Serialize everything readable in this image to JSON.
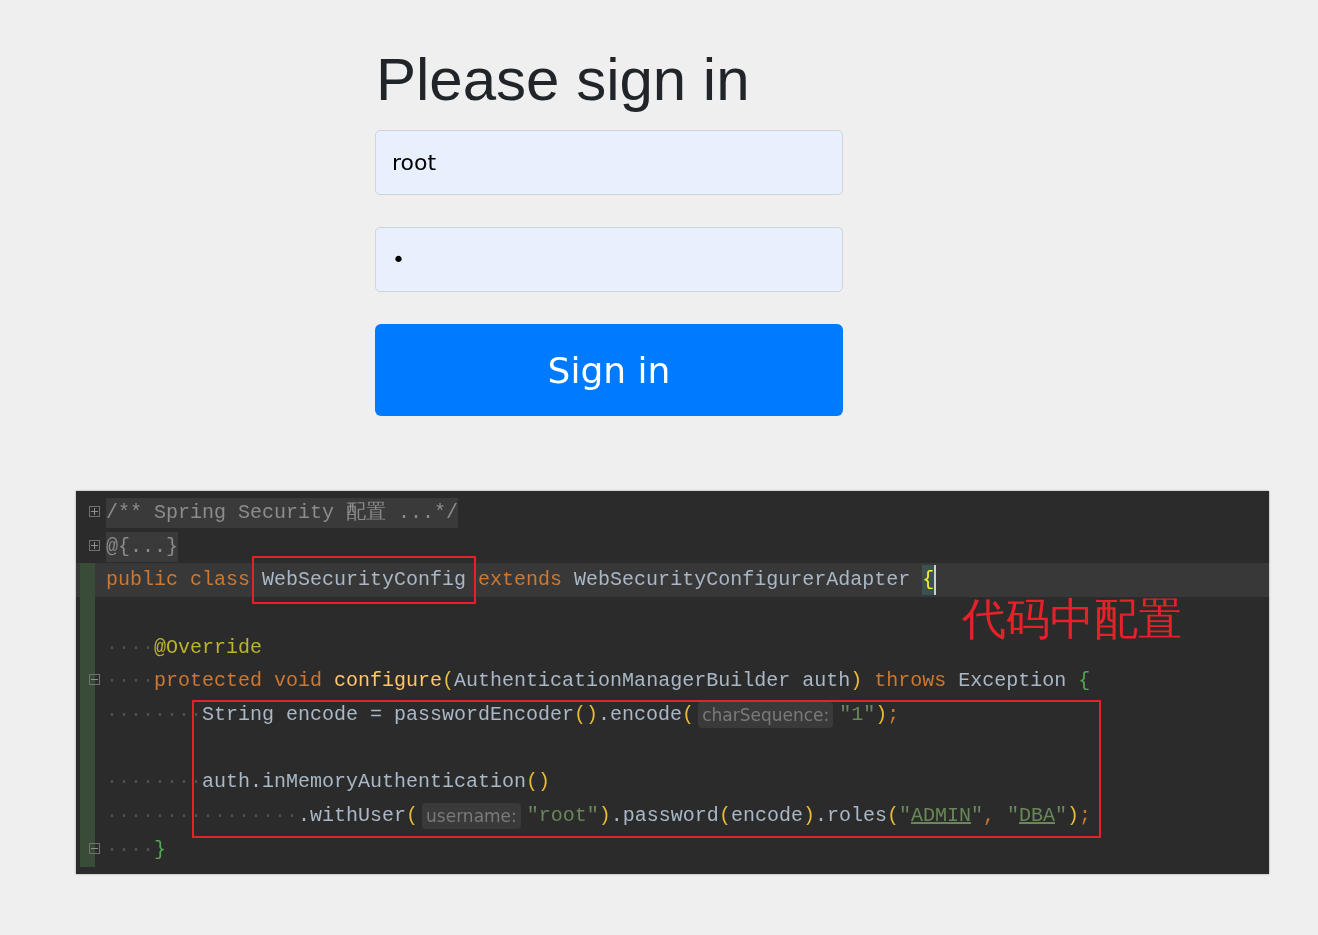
{
  "login": {
    "heading": "Please sign in",
    "username": {
      "value": "root"
    },
    "password": {
      "value": "•"
    },
    "button": "Sign in"
  },
  "code_editor": {
    "lines": [
      {
        "kind": "code",
        "fold": {
          "collapsed": true
        },
        "tokens": [
          {
            "kind": "folded",
            "text": "/** Spring Security 配置 ...*/"
          }
        ]
      },
      {
        "kind": "code",
        "fold": {
          "collapsed": true
        },
        "tokens": [
          {
            "kind": "folded",
            "text": "@{...}"
          }
        ]
      },
      {
        "kind": "code",
        "current": true,
        "tokens": [
          {
            "kind": "keyword",
            "text": "public class "
          },
          {
            "kind": "plain",
            "text": "WebSecurityConfig",
            "framed": true
          },
          {
            "kind": "keyword",
            "text": " extends "
          },
          {
            "kind": "plain",
            "text": "WebSecurityConfigurerAdapter "
          },
          {
            "kind": "brace_match",
            "text": "{"
          }
        ]
      },
      {
        "kind": "blank"
      },
      {
        "kind": "code",
        "tokens": [
          {
            "kind": "ws",
            "text": "····"
          },
          {
            "kind": "annotation",
            "text": "@Override"
          }
        ]
      },
      {
        "kind": "code",
        "fold": {
          "collapsed": false
        },
        "tokens": [
          {
            "kind": "ws",
            "text": "····"
          },
          {
            "kind": "keyword",
            "text": "protected void "
          },
          {
            "kind": "method",
            "text": "configure"
          },
          {
            "kind": "paren",
            "text": "("
          },
          {
            "kind": "plain",
            "text": "AuthenticationManagerBuilder auth"
          },
          {
            "kind": "paren",
            "text": ")"
          },
          {
            "kind": "keyword",
            "text": " throws "
          },
          {
            "kind": "plain",
            "text": "Exception "
          },
          {
            "kind": "brace",
            "text": "{"
          }
        ]
      },
      {
        "kind": "code",
        "tokens": [
          {
            "kind": "ws",
            "text": "········"
          },
          {
            "kind": "plain",
            "text": "String encode = passwordEncoder"
          },
          {
            "kind": "paren",
            "text": "()"
          },
          {
            "kind": "plain",
            "text": ".encode"
          },
          {
            "kind": "paren",
            "text": "("
          },
          {
            "kind": "hint",
            "text": "charSequence:"
          },
          {
            "kind": "string",
            "text": "\"1\""
          },
          {
            "kind": "paren",
            "text": ")"
          },
          {
            "kind": "keyword",
            "text": ";"
          }
        ]
      },
      {
        "kind": "blank"
      },
      {
        "kind": "code",
        "tokens": [
          {
            "kind": "ws",
            "text": "········"
          },
          {
            "kind": "plain",
            "text": "auth.inMemoryAuthentication"
          },
          {
            "kind": "paren",
            "text": "()"
          }
        ]
      },
      {
        "kind": "code",
        "tokens": [
          {
            "kind": "ws",
            "text": "················"
          },
          {
            "kind": "plain",
            "text": ".withUser"
          },
          {
            "kind": "paren",
            "text": "("
          },
          {
            "kind": "hint",
            "text": "username:"
          },
          {
            "kind": "string",
            "text": "\"root\""
          },
          {
            "kind": "paren",
            "text": ")"
          },
          {
            "kind": "plain",
            "text": ".password"
          },
          {
            "kind": "paren",
            "text": "("
          },
          {
            "kind": "plain",
            "text": "encode"
          },
          {
            "kind": "paren",
            "text": ")"
          },
          {
            "kind": "plain",
            "text": ".roles"
          },
          {
            "kind": "paren",
            "text": "("
          },
          {
            "kind": "string",
            "text": "\""
          },
          {
            "kind": "string_link",
            "text": "ADMIN"
          },
          {
            "kind": "string",
            "text": "\""
          },
          {
            "kind": "keyword",
            "text": ", "
          },
          {
            "kind": "string",
            "text": "\""
          },
          {
            "kind": "string_link",
            "text": "DBA"
          },
          {
            "kind": "string",
            "text": "\""
          },
          {
            "kind": "paren",
            "text": ")"
          },
          {
            "kind": "keyword",
            "text": ";"
          }
        ]
      },
      {
        "kind": "code",
        "fold": {
          "collapsed": false
        },
        "tokens": [
          {
            "kind": "ws",
            "text": "····"
          },
          {
            "kind": "brace",
            "text": "}"
          }
        ]
      }
    ],
    "annotation_text": "代码中配置"
  }
}
